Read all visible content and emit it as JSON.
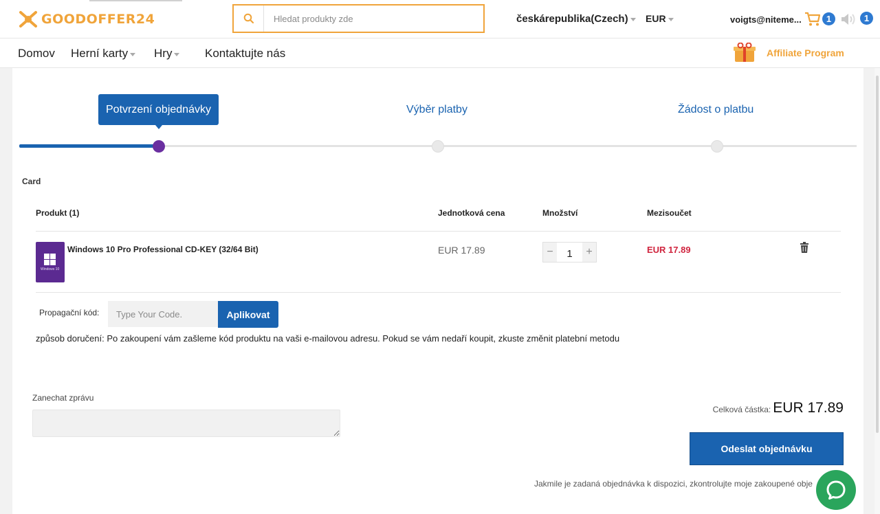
{
  "header": {
    "logo_text": "GOODOFFER24",
    "search_placeholder": "Hledat produkty zde",
    "country": "českárepublika(Czech)",
    "currency": "EUR",
    "user_email": "voigts@niteme...",
    "cart_count": "1",
    "notification_count": "1"
  },
  "nav": {
    "items": [
      "Domov",
      "Herní karty",
      "Hry",
      "Kontaktujte nás"
    ],
    "affiliate": "Affiliate Program"
  },
  "steps": [
    "Potvrzení objednávky",
    "Výběr platby",
    "Žádost o platbu"
  ],
  "cart": {
    "title": "Card",
    "columns": [
      "Produkt (1)",
      "Jednotková cena",
      "Množství",
      "Mezisoučet"
    ],
    "items": [
      {
        "image_text": "Windows 10",
        "name": "Windows 10 Pro Professional CD-KEY (32/64 Bit)",
        "unit_price": "EUR 17.89",
        "quantity": "1",
        "subtotal": "EUR 17.89"
      }
    ],
    "promo_label": "Propagační kód:",
    "promo_placeholder": "Type Your Code.",
    "promo_button": "Aplikovat",
    "delivery_note": "způsob doručení: Po zakoupení vám zašleme kód produktu na vaši e-mailovou adresu. Pokud se vám nedaří koupit, zkuste změnit platební metodu",
    "message_label": "Zanechat zprávu",
    "total_label": "Celková částka:",
    "total_value": "EUR 17.89",
    "submit_button": "Odeslat objednávku",
    "after_note": "Jakmile je zadaná objednávka k dispozici, zkontrolujte moje zakoupené obje"
  },
  "colors": {
    "brand": "#f0a43a",
    "primary": "#1a63b0",
    "price": "#d0243e",
    "progress_dot": "#6a2fa0",
    "chat": "#2aa55c"
  }
}
